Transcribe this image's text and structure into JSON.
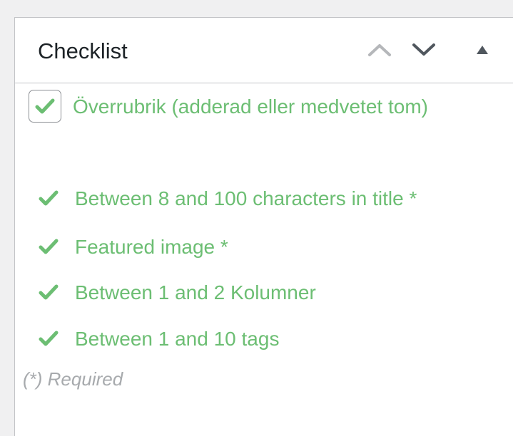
{
  "panel": {
    "title": "Checklist",
    "buttons": {
      "move_up": "move-up",
      "move_down": "move-down",
      "toggle": "toggle-panel"
    }
  },
  "checklist": {
    "items": [
      {
        "label": "Överrubrik (adderad eller medvetet tom)",
        "checked": true,
        "type": "checkbox"
      },
      {
        "label": "Between 8 and 100 characters in title *",
        "checked": true,
        "type": "auto"
      },
      {
        "label": "Featured image *",
        "checked": true,
        "type": "auto"
      },
      {
        "label": "Between 1 and 2 Kolumner",
        "checked": true,
        "type": "auto"
      },
      {
        "label": "Between 1 and 10 tags",
        "checked": true,
        "type": "auto"
      }
    ],
    "required_note": "(*) Required"
  },
  "colors": {
    "success": "#6cbe73",
    "text": "#1d2327",
    "muted": "#a7aaad",
    "border": "#c3c4c7",
    "background": "#f0f0f1"
  },
  "icons": {
    "up": "chevron-up-icon",
    "down": "chevron-down-icon",
    "toggle": "triangle-up-icon",
    "check": "checkmark-icon"
  }
}
